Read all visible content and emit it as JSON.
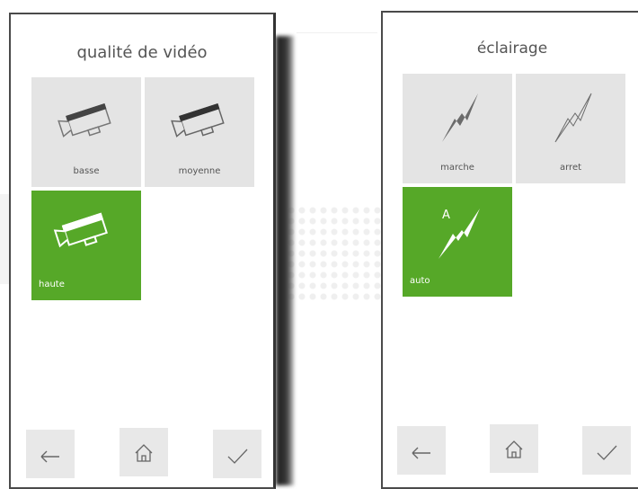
{
  "video_quality": {
    "title": "qualité de vidéo",
    "options": [
      {
        "label": "basse",
        "selected": false
      },
      {
        "label": "moyenne",
        "selected": false
      },
      {
        "label": "haute",
        "selected": true
      }
    ]
  },
  "lighting": {
    "title": "éclairage",
    "options": [
      {
        "label": "marche",
        "selected": false
      },
      {
        "label": "arret",
        "selected": false
      },
      {
        "label": "auto",
        "selected": true,
        "badge": "A"
      }
    ]
  },
  "nav": {
    "back_icon": "arrow-left-icon",
    "home_icon": "home-icon",
    "confirm_icon": "checkmark-icon"
  },
  "colors": {
    "selected_tile": "#56a828",
    "tile": "#e4e4e4",
    "nav_button": "#e8e8e8",
    "title_text": "#555555"
  }
}
